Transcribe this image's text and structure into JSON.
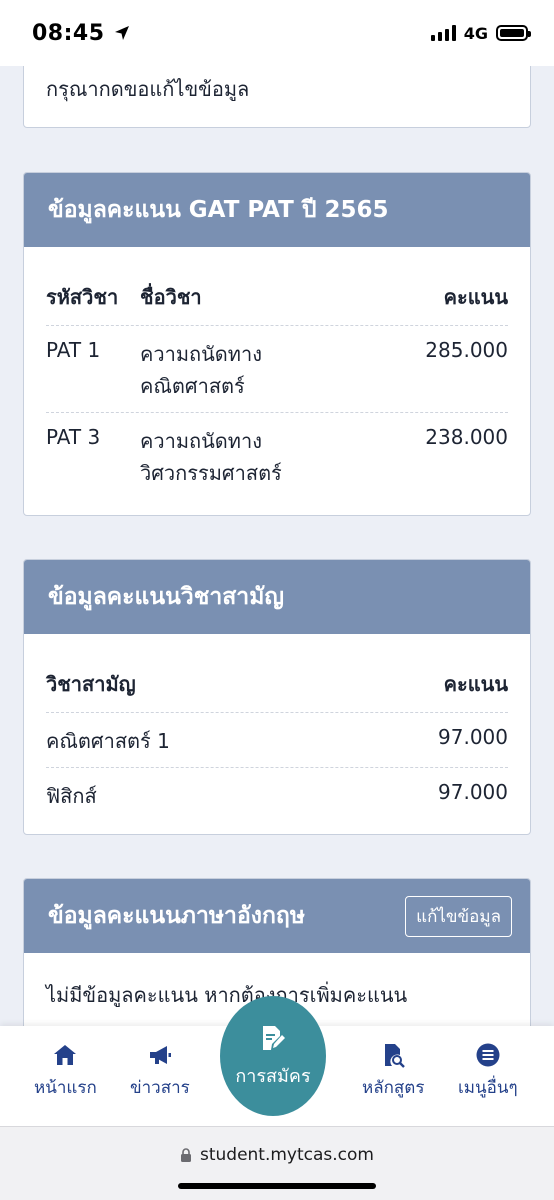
{
  "status_bar": {
    "time": "08:45",
    "network": "4G"
  },
  "top_card": {
    "text": "กรุณากดขอแก้ไขข้อมูล"
  },
  "gat_pat": {
    "title": "ข้อมูลคะแนน GAT PAT ปี 2565",
    "headers": [
      "รหัสวิชา",
      "ชื่อวิชา",
      "คะแนน"
    ],
    "rows": [
      {
        "code": "PAT 1",
        "name_line1": "ความถนัดทาง",
        "name_line2": "คณิตศาสตร์",
        "score": "285.000"
      },
      {
        "code": "PAT 3",
        "name_line1": "ความถนัดทาง",
        "name_line2": "วิศวกรรมศาสตร์",
        "score": "238.000"
      }
    ]
  },
  "common_subjects": {
    "title": "ข้อมูลคะแนนวิชาสามัญ",
    "headers": [
      "วิชาสามัญ",
      "คะแนน"
    ],
    "rows": [
      {
        "name": "คณิตศาสตร์ 1",
        "score": "97.000"
      },
      {
        "name": "ฟิสิกส์",
        "score": "97.000"
      }
    ]
  },
  "english": {
    "title": "ข้อมูลคะแนนภาษาอังกฤษ",
    "edit_label": "แก้ไขข้อมูล",
    "note": "ไม่มีข้อมูลคะแนน หากต้องการเพิ่มคะแนน"
  },
  "bottom_nav": {
    "home": "หน้าแรก",
    "news": "ข่าวสาร",
    "apply": "การสมัคร",
    "courses": "หลักสูตร",
    "more": "เมนูอื่นๆ"
  },
  "browser": {
    "url": "student.mytcas.com"
  },
  "colors": {
    "header_bg": "#7a90b2",
    "nav_color": "#24418a",
    "apply_bg": "#3c8e9c"
  }
}
